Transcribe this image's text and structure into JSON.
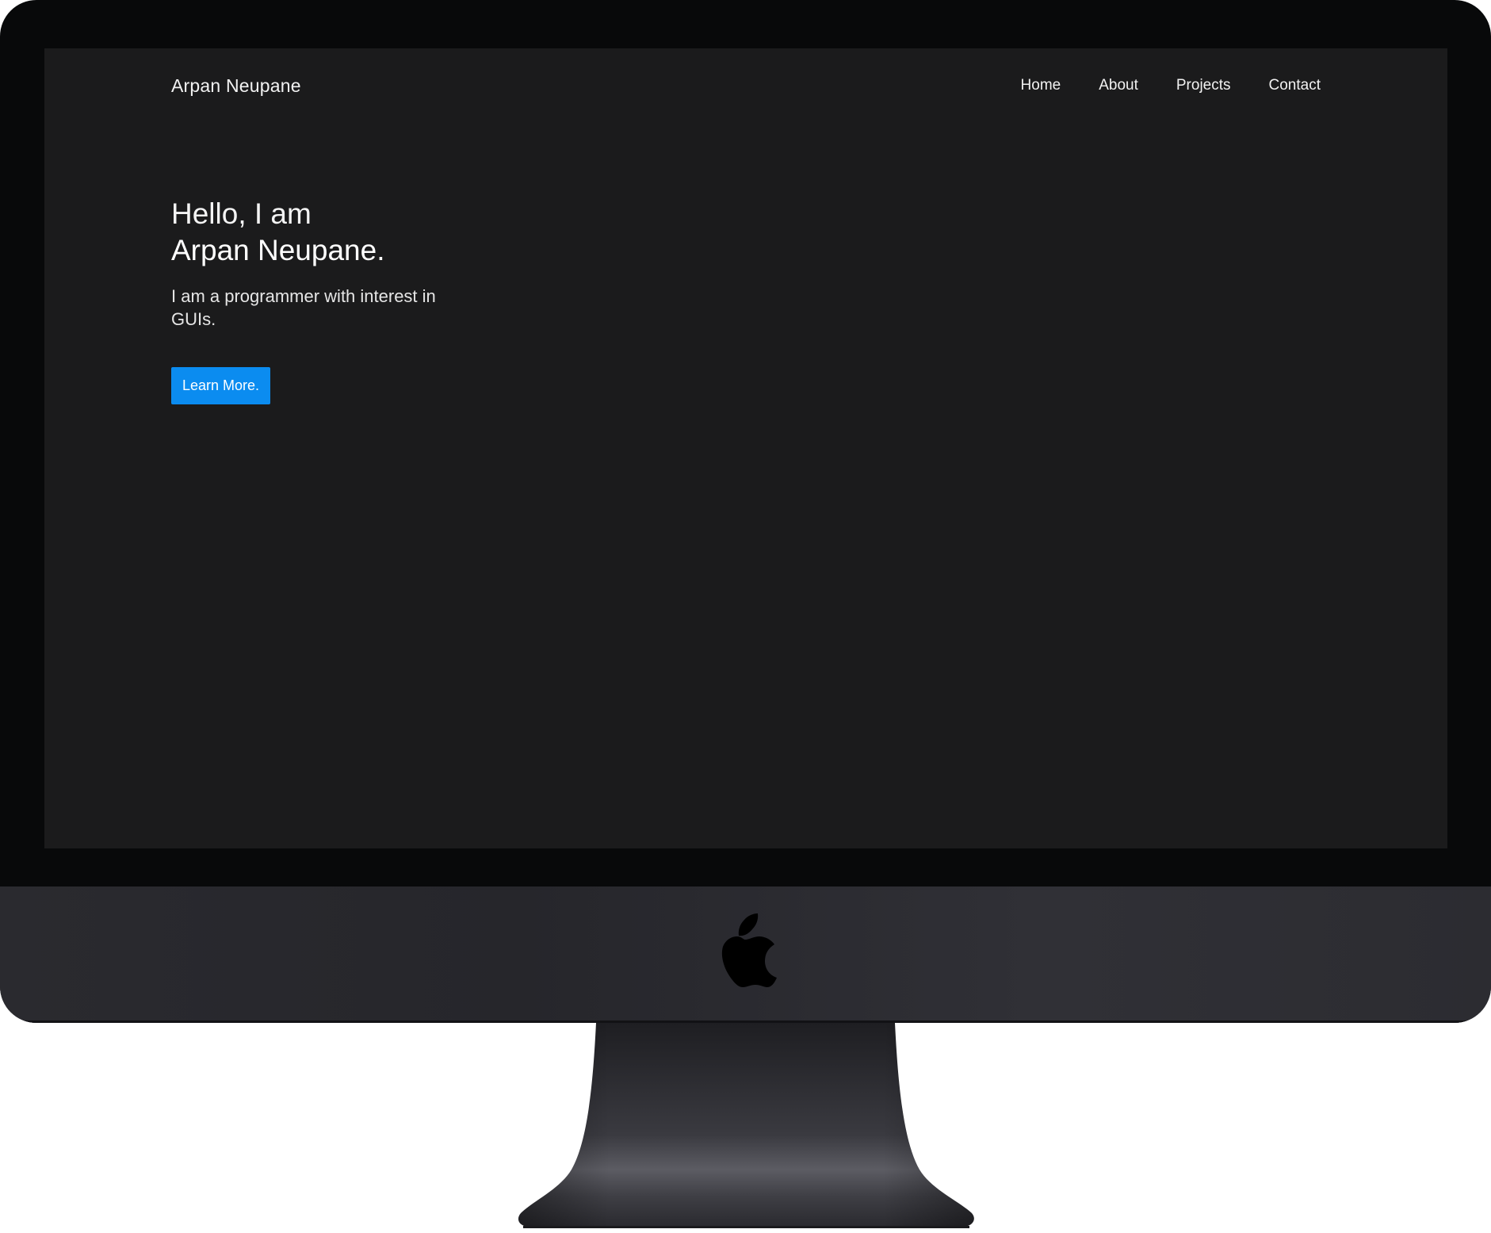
{
  "site": {
    "brand": "Arpan Neupane",
    "nav": [
      {
        "label": "Home"
      },
      {
        "label": "About"
      },
      {
        "label": "Projects"
      },
      {
        "label": "Contact"
      }
    ]
  },
  "hero": {
    "greeting": "Hello, I am",
    "name": "Arpan Neupane.",
    "tagline": "I am a programmer with interest in GUIs.",
    "cta_label": "Learn More."
  },
  "colors": {
    "screen_bg": "#1b1b1c",
    "accent": "#0b8cf0",
    "text": "#ffffff",
    "bezel": "#08090a"
  },
  "icons": {
    "device_logo": "apple-logo-icon"
  }
}
